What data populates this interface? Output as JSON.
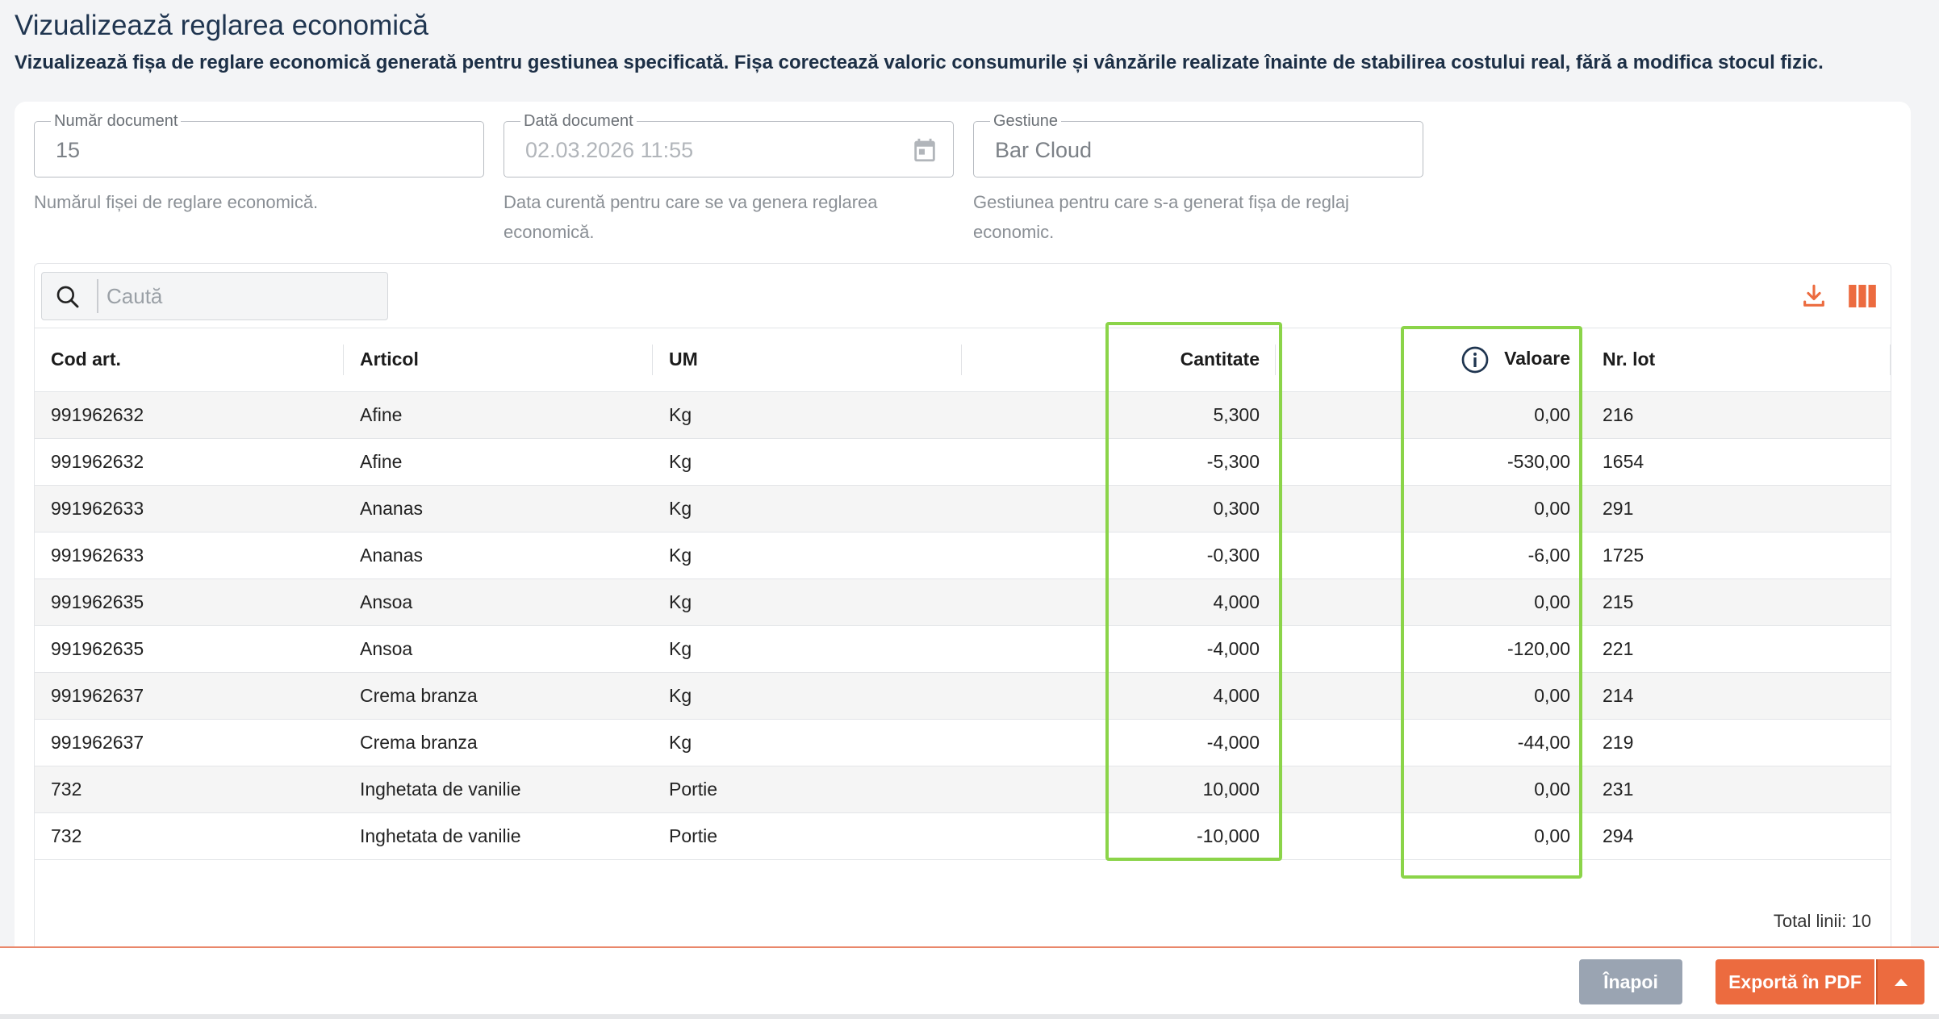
{
  "page": {
    "title": "Vizualizează reglarea economică",
    "subtitle": "Vizualizează fișa de reglare economică generată pentru gestiunea specificată. Fișa corectează valoric consumurile și vânzările realizate înainte de stabilirea costului real, fără a modifica stocul fizic."
  },
  "form": {
    "doc_number": {
      "label": "Număr document",
      "value": "15",
      "helper": "Numărul fișei de reglare economică."
    },
    "doc_date": {
      "label": "Dată document",
      "value": "02.03.2026 11:55",
      "helper": "Data curentă pentru care se va genera reglarea economică."
    },
    "warehouse": {
      "label": "Gestiune",
      "value": "Bar Cloud",
      "helper": "Gestiunea pentru care s-a generat fișa de reglaj economic."
    }
  },
  "search": {
    "placeholder": "Caută"
  },
  "table": {
    "columns": [
      "Cod art.",
      "Articol",
      "UM",
      "",
      "Cantitate",
      "",
      "Valoare",
      "Nr. lot"
    ],
    "rows": [
      [
        "991962632",
        "Afine",
        "Kg",
        "5,300",
        "0,00",
        "216"
      ],
      [
        "991962632",
        "Afine",
        "Kg",
        "-5,300",
        "-530,00",
        "1654"
      ],
      [
        "991962633",
        "Ananas",
        "Kg",
        "0,300",
        "0,00",
        "291"
      ],
      [
        "991962633",
        "Ananas",
        "Kg",
        "-0,300",
        "-6,00",
        "1725"
      ],
      [
        "991962635",
        "Ansoa",
        "Kg",
        "4,000",
        "0,00",
        "215"
      ],
      [
        "991962635",
        "Ansoa",
        "Kg",
        "-4,000",
        "-120,00",
        "221"
      ],
      [
        "991962637",
        "Crema branza",
        "Kg",
        "4,000",
        "0,00",
        "214"
      ],
      [
        "991962637",
        "Crema branza",
        "Kg",
        "-4,000",
        "-44,00",
        "219"
      ],
      [
        "732",
        "Inghetata de vanilie",
        "Portie",
        "10,000",
        "0,00",
        "231"
      ],
      [
        "732",
        "Inghetata de vanilie",
        "Portie",
        "-10,000",
        "0,00",
        "294"
      ]
    ],
    "total": "Total linii: 10"
  },
  "footer": {
    "back_label": "Înapoi",
    "export_label": "Exportă în PDF"
  },
  "colors": {
    "accent": "#ec6b3f",
    "highlight": "#8bd449",
    "title": "#1f3550"
  }
}
